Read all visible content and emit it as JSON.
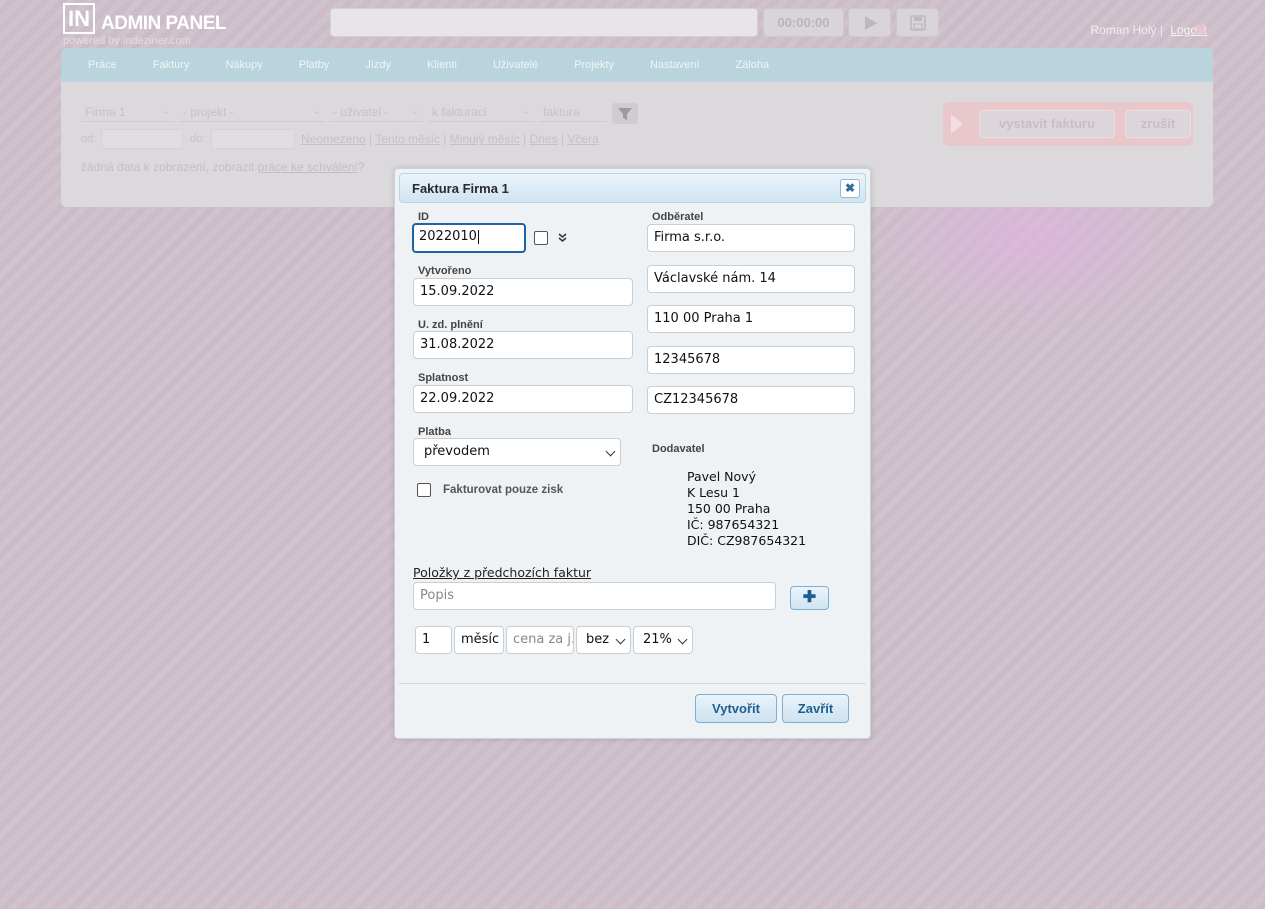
{
  "header": {
    "logo_box": "IN",
    "logo_title": "ADMIN PANEL",
    "logo_sub": "powered by indeziner.com",
    "timer": "00:00:00",
    "user": "Roman Holý |",
    "logout": "Logout"
  },
  "nav": [
    "Práce",
    "Faktury",
    "Nákupy",
    "Platby",
    "Jízdy",
    "Klienti",
    "Uživatelé",
    "Projekty",
    "Nastavení",
    "Záloha"
  ],
  "filters": {
    "company": "Firma 1",
    "project": "- projekt -",
    "user": "- uživatel -",
    "state": "k fakturaci",
    "invoice_placeholder": "faktura",
    "from_label": "od:",
    "to_label": "do:",
    "links": [
      "Neomezeno",
      "Tento měsíc",
      "Minulý měsíc",
      "Dnes",
      "Včera"
    ],
    "no_data_text": "žádná data k zobrazení, zobrazit ",
    "no_data_link": "práce ke schválení",
    "no_data_end": "?"
  },
  "actions": {
    "create_invoice": "vystavit fakturu",
    "cancel": "zrušit"
  },
  "dialog": {
    "title": "Faktura Firma 1",
    "id_label": "ID",
    "id_value": "2022010",
    "created_label": "Vytvořeno",
    "created_value": "15.09.2022",
    "tax_date_label": "U. zd. plnění",
    "tax_date_value": "31.08.2022",
    "due_label": "Splatnost",
    "due_value": "22.09.2022",
    "payment_label": "Platba",
    "payment_value": "převodem",
    "profit_only_label": "Fakturovat pouze zisk",
    "customer_label": "Odběratel",
    "customer": [
      "Firma s.r.o.",
      "Václavské nám. 14",
      "110 00 Praha 1",
      "12345678",
      "CZ12345678"
    ],
    "supplier_label": "Dodavatel",
    "supplier": [
      "Pavel Nový",
      "K Lesu 1",
      "150 00 Praha",
      "IČ: 987654321",
      "DIČ: CZ987654321"
    ],
    "prev_items_link": "Položky z předchozích faktur",
    "description_placeholder": "Popis",
    "quantity": "1",
    "unit": "měsíc",
    "price_placeholder": "cena za j.",
    "vat_mode": "bez",
    "vat_rate": "21%",
    "create_button": "Vytvořit",
    "close_button": "Zavřít"
  }
}
